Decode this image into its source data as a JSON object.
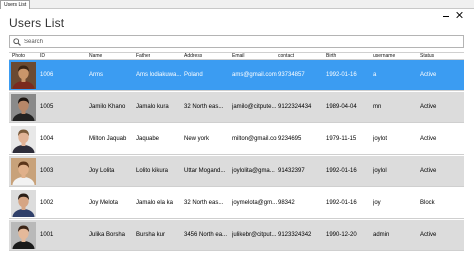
{
  "window": {
    "tab_label": "Users List"
  },
  "page": {
    "title": "Users List"
  },
  "search": {
    "placeholder": "Search",
    "value": ""
  },
  "table": {
    "columns": [
      "Photo",
      "ID",
      "Name",
      "Father",
      "Address",
      "Email",
      "contact",
      "Birth",
      "username",
      "Status"
    ],
    "rows": [
      {
        "id": "1006",
        "name": "Arms",
        "father": "Ams lodiakuwa...",
        "address": "Poland",
        "email": "ams@gmail.com",
        "contact": "93734857",
        "birth": "1992-01-16",
        "username": "a",
        "status": "Active",
        "selected": true,
        "photo": {
          "bg": "#6b4a32",
          "skin": "#c9956a",
          "hair": "#3a2415",
          "shirt": "#7a2a1f"
        }
      },
      {
        "id": "1005",
        "name": "Jamilo Khano",
        "father": "Jamalo kura",
        "address": "32 North eas...",
        "email": "jamilo@citpute...",
        "contact": "9122324434",
        "birth": "1989-04-04",
        "username": "mn",
        "status": "Active",
        "selected": false,
        "photo": {
          "bg": "#8a8a8a",
          "skin": "#b78768",
          "hair": "#1c1410",
          "shirt": "#222222"
        }
      },
      {
        "id": "1004",
        "name": "Milton Jaquab",
        "father": "Jaquabe",
        "address": "New york",
        "email": "milton@gmail.com",
        "contact": "9234695",
        "birth": "1979-11-15",
        "username": "joylot",
        "status": "Active",
        "selected": false,
        "photo": {
          "bg": "#e8e8e8",
          "skin": "#e2b497",
          "hair": "#7a5a3a",
          "shirt": "#2d2d3a"
        }
      },
      {
        "id": "1003",
        "name": "Joy Lolita",
        "father": "Lolito kikura",
        "address": "Uttar Mogand...",
        "email": "joylolita@gma...",
        "contact": "91432397",
        "birth": "1992-01-16",
        "username": "joylol",
        "status": "Active",
        "selected": false,
        "photo": {
          "bg": "#c8a27a",
          "skin": "#e0b08a",
          "hair": "#5a3418",
          "shirt": "#f2f2f2"
        }
      },
      {
        "id": "1002",
        "name": "Joy Melota",
        "father": "Jamalo ela ka",
        "address": "32 North eas...",
        "email": "joymelota@gm...",
        "contact": "98342",
        "birth": "1992-01-16",
        "username": "joy",
        "status": "Block",
        "selected": false,
        "photo": {
          "bg": "#dcdcdc",
          "skin": "#d6a584",
          "hair": "#2a1e16",
          "shirt": "#30406a"
        }
      },
      {
        "id": "1001",
        "name": "Julika Borsha",
        "father": "Bursha kur",
        "address": "3456 North ea...",
        "email": "julikebr@citput...",
        "contact": "9123324342",
        "birth": "1990-12-20",
        "username": "admin",
        "status": "Active",
        "selected": false,
        "photo": {
          "bg": "#b9b9b9",
          "skin": "#e4b99a",
          "hair": "#3b2416",
          "shirt": "#1a1a1a"
        }
      }
    ]
  },
  "colors": {
    "selected_row": "#3b9cf2",
    "alt_row": "#dcdcdc",
    "normal_row": "#ffffff",
    "selected_text": "#ffffff"
  }
}
